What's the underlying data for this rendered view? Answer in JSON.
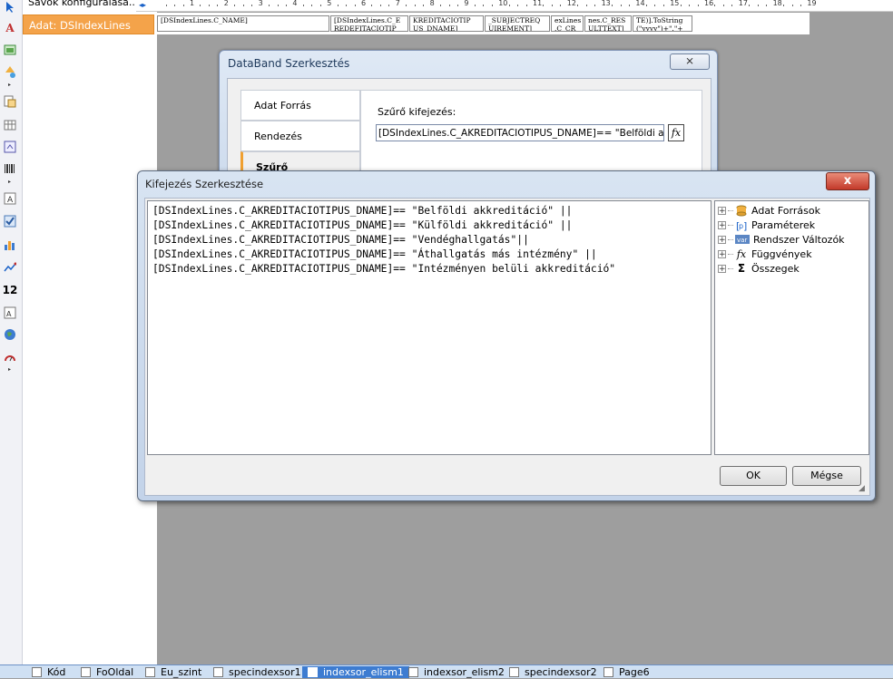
{
  "band_panel": {
    "row1": "Sávok konfigurálása...",
    "row2": "Adat: DSIndexLines"
  },
  "ruler": {
    "ticks": [
      "1",
      "2",
      "3",
      "4",
      "5",
      "6",
      "7",
      "8",
      "9",
      "10",
      "11",
      "12",
      "13",
      "14",
      "15",
      "16",
      "17",
      "18",
      "19"
    ]
  },
  "page_cells": [
    "[DSIndexLines.C_NAME]",
    "[DSIndexLines.C_E REDEFITACIOTIP",
    "KREDITACIOTIP US_DNAME]",
    "_SUBJECTREQ UIREMENT]",
    "exLines .C_CR",
    "nes.C_RES ULTTEXT]",
    "TE)].ToString (\"yyyy\")+\".\"+"
  ],
  "databand_dialog": {
    "title": "DataBand Szerkesztés",
    "close": "⨯",
    "tabs": [
      "Adat Forrás",
      "Rendezés",
      "Szűrő"
    ],
    "filter_label": "Szűrő kifejezés:",
    "filter_value": "[DSIndexLines.C_AKREDITACIOTIPUS_DNAME]== \"Belföldi akkreditáció\" ||",
    "fx": "fx"
  },
  "expr_dialog": {
    "title": "Kifejezés Szerkesztése",
    "close": "x",
    "lines": [
      "[DSIndexLines.C_AKREDITACIOTIPUS_DNAME]== \"Belföldi akkreditáció\" ||",
      "[DSIndexLines.C_AKREDITACIOTIPUS_DNAME]== \"Külföldi akkreditáció\" ||",
      "[DSIndexLines.C_AKREDITACIOTIPUS_DNAME]== \"Vendéghallgatás\"||",
      "[DSIndexLines.C_AKREDITACIOTIPUS_DNAME]== \"Áthallgatás más intézmény\" ||",
      "[DSIndexLines.C_AKREDITACIOTIPUS_DNAME]== \"Intézményen belüli akkreditáció\""
    ],
    "tree": [
      {
        "label": "Adat Források",
        "icon": "database-icon"
      },
      {
        "label": "Paraméterek",
        "icon": "parameter-icon"
      },
      {
        "label": "Rendszer Változók",
        "icon": "variable-icon"
      },
      {
        "label": "Függvények",
        "icon": "function-icon"
      },
      {
        "label": "Összegek",
        "icon": "sum-icon"
      }
    ],
    "ok": "OK",
    "cancel": "Mégse"
  },
  "bottom_tabs": [
    "Kód",
    "FoOldal",
    "Eu_szint",
    "specindexsor1",
    "indexsor_elism1",
    "indexsor_elism2",
    "specindexsor2",
    "Page6"
  ],
  "active_tab": "indexsor_elism1",
  "colors": {
    "accent": "#f4a34a",
    "selected_tab": "#3d7cd1",
    "close_red": "#c3392a"
  }
}
